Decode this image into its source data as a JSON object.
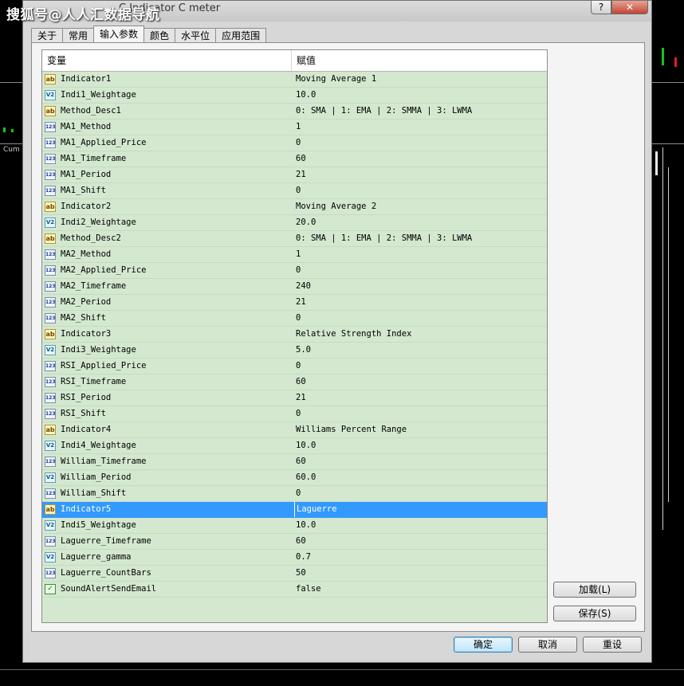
{
  "watermark": "搜狐号@人人汇数据导航",
  "window": {
    "title": "C    Indicator  C          meter",
    "help_label": "?",
    "close_label": "✕"
  },
  "left_chart_label": "Cum",
  "tabs": [
    {
      "label": "关于"
    },
    {
      "label": "常用"
    },
    {
      "label": "输入参数",
      "active": true
    },
    {
      "label": "颜色"
    },
    {
      "label": "水平位"
    },
    {
      "label": "应用范围"
    }
  ],
  "table": {
    "col_variable": "变量",
    "col_value": "赋值",
    "rows": [
      {
        "type": "string",
        "name": "Indicator1",
        "value": "Moving Average 1"
      },
      {
        "type": "double",
        "name": "Indi1_Weightage",
        "value": "10.0"
      },
      {
        "type": "string",
        "name": "Method_Desc1",
        "value": "0: SMA | 1: EMA | 2: SMMA | 3: LWMA"
      },
      {
        "type": "int",
        "name": "MA1_Method",
        "value": "1"
      },
      {
        "type": "int",
        "name": "MA1_Applied_Price",
        "value": "0"
      },
      {
        "type": "int",
        "name": "MA1_Timeframe",
        "value": "60"
      },
      {
        "type": "int",
        "name": "MA1_Period",
        "value": "21"
      },
      {
        "type": "int",
        "name": "MA1_Shift",
        "value": "0"
      },
      {
        "type": "string",
        "name": "Indicator2",
        "value": "Moving Average 2"
      },
      {
        "type": "double",
        "name": "Indi2_Weightage",
        "value": "20.0"
      },
      {
        "type": "string",
        "name": "Method_Desc2",
        "value": "0: SMA | 1: EMA | 2: SMMA | 3: LWMA"
      },
      {
        "type": "int",
        "name": "MA2_Method",
        "value": "1"
      },
      {
        "type": "int",
        "name": "MA2_Applied_Price",
        "value": "0"
      },
      {
        "type": "int",
        "name": "MA2_Timeframe",
        "value": "240"
      },
      {
        "type": "int",
        "name": "MA2_Period",
        "value": "21"
      },
      {
        "type": "int",
        "name": "MA2_Shift",
        "value": "0"
      },
      {
        "type": "string",
        "name": "Indicator3",
        "value": "Relative Strength Index"
      },
      {
        "type": "double",
        "name": "Indi3_Weightage",
        "value": "5.0"
      },
      {
        "type": "int",
        "name": "RSI_Applied_Price",
        "value": "0"
      },
      {
        "type": "int",
        "name": "RSI_Timeframe",
        "value": "60"
      },
      {
        "type": "int",
        "name": "RSI_Period",
        "value": "21"
      },
      {
        "type": "int",
        "name": "RSI_Shift",
        "value": "0"
      },
      {
        "type": "string",
        "name": "Indicator4",
        "value": "Williams Percent Range"
      },
      {
        "type": "double",
        "name": "Indi4_Weightage",
        "value": "10.0"
      },
      {
        "type": "int",
        "name": "William_Timeframe",
        "value": "60"
      },
      {
        "type": "double",
        "name": "William_Period",
        "value": "60.0"
      },
      {
        "type": "int",
        "name": "William_Shift",
        "value": "0"
      },
      {
        "type": "string",
        "name": "Indicator5",
        "value": "Laguerre",
        "selected": true
      },
      {
        "type": "double",
        "name": "Indi5_Weightage",
        "value": "10.0"
      },
      {
        "type": "int",
        "name": "Laguerre_Timeframe",
        "value": "60"
      },
      {
        "type": "double",
        "name": "Laguerre_gamma",
        "value": "0.7"
      },
      {
        "type": "int",
        "name": "Laguerre_CountBars",
        "value": "50"
      },
      {
        "type": "bool",
        "name": "SoundAlertSendEmail",
        "value": "false"
      }
    ]
  },
  "icons": {
    "string": "ab",
    "double": "V2",
    "int": "123",
    "bool": "✓"
  },
  "buttons": {
    "load": "加载(L)",
    "save": "保存(S)",
    "ok": "确定",
    "cancel": "取消",
    "reset": "重设"
  },
  "colors": {
    "row_bg": "#d3e8cf",
    "selected_bg": "#3399ff",
    "dialog_bg": "#d7d7d7"
  }
}
